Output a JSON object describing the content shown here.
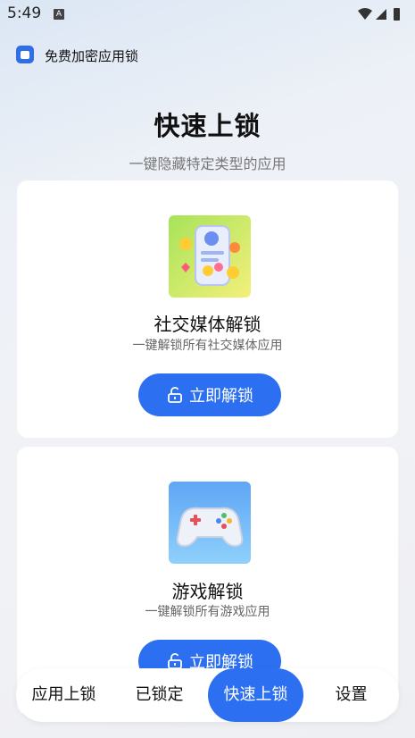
{
  "status_bar": {
    "time": "5:49",
    "notification_badge": "A"
  },
  "app": {
    "name": "免费加密应用锁"
  },
  "page": {
    "title": "快速上锁",
    "subtitle": "一键隐藏特定类型的应用"
  },
  "cards": [
    {
      "icon": "social-media-icon",
      "title": "社交媒体解锁",
      "description": "一键解锁所有社交媒体应用",
      "button_label": "立即解锁"
    },
    {
      "icon": "gamepad-icon",
      "title": "游戏解锁",
      "description": "一键解锁所有游戏应用",
      "button_label": "立即解锁"
    }
  ],
  "bottom_nav": {
    "items": [
      {
        "label": "应用上锁"
      },
      {
        "label": "已锁定"
      },
      {
        "label": "快速上锁"
      },
      {
        "label": "设置"
      }
    ],
    "active_index": 2
  },
  "colors": {
    "accent": "#2c6ff0",
    "card_bg": "#ffffff"
  }
}
